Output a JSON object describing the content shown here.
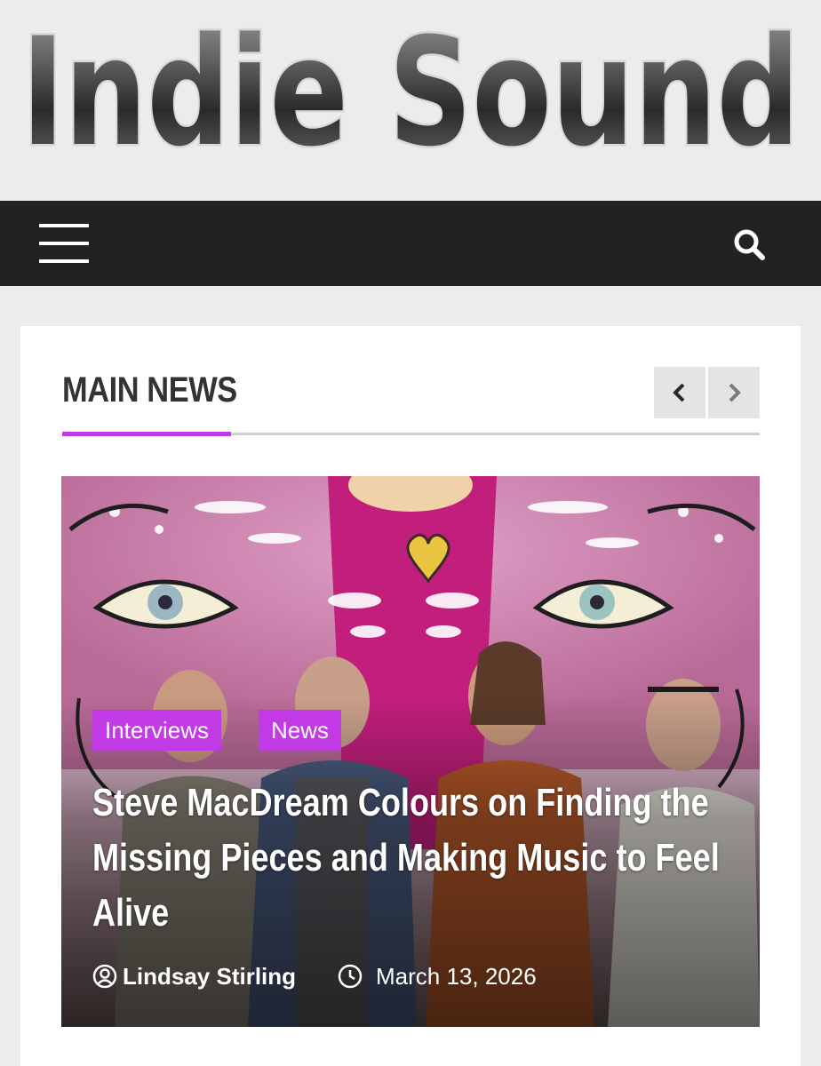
{
  "site": {
    "logo_text": "Indie Sound"
  },
  "navbar": {
    "menu_icon": "hamburger-menu-icon",
    "search_icon": "search-icon"
  },
  "section": {
    "title": "MAIN NEWS",
    "prev_icon": "chevron-left-icon",
    "next_icon": "chevron-right-icon"
  },
  "featured": {
    "image_description_icon": "band-photo",
    "tags": [
      "Interviews",
      "News"
    ],
    "title": "Steve MacDream Colours on Finding the Missing Pieces and Making Music to Feel Alive",
    "author": "Lindsay Stirling",
    "date": "March 13, 2026",
    "author_icon": "user-circle-icon",
    "date_icon": "clock-icon"
  },
  "colors": {
    "accent": "#c13ae6",
    "navbar": "#222222",
    "page_bg": "#ececec",
    "card_bg": "#ffffff",
    "heading": "#333333"
  }
}
